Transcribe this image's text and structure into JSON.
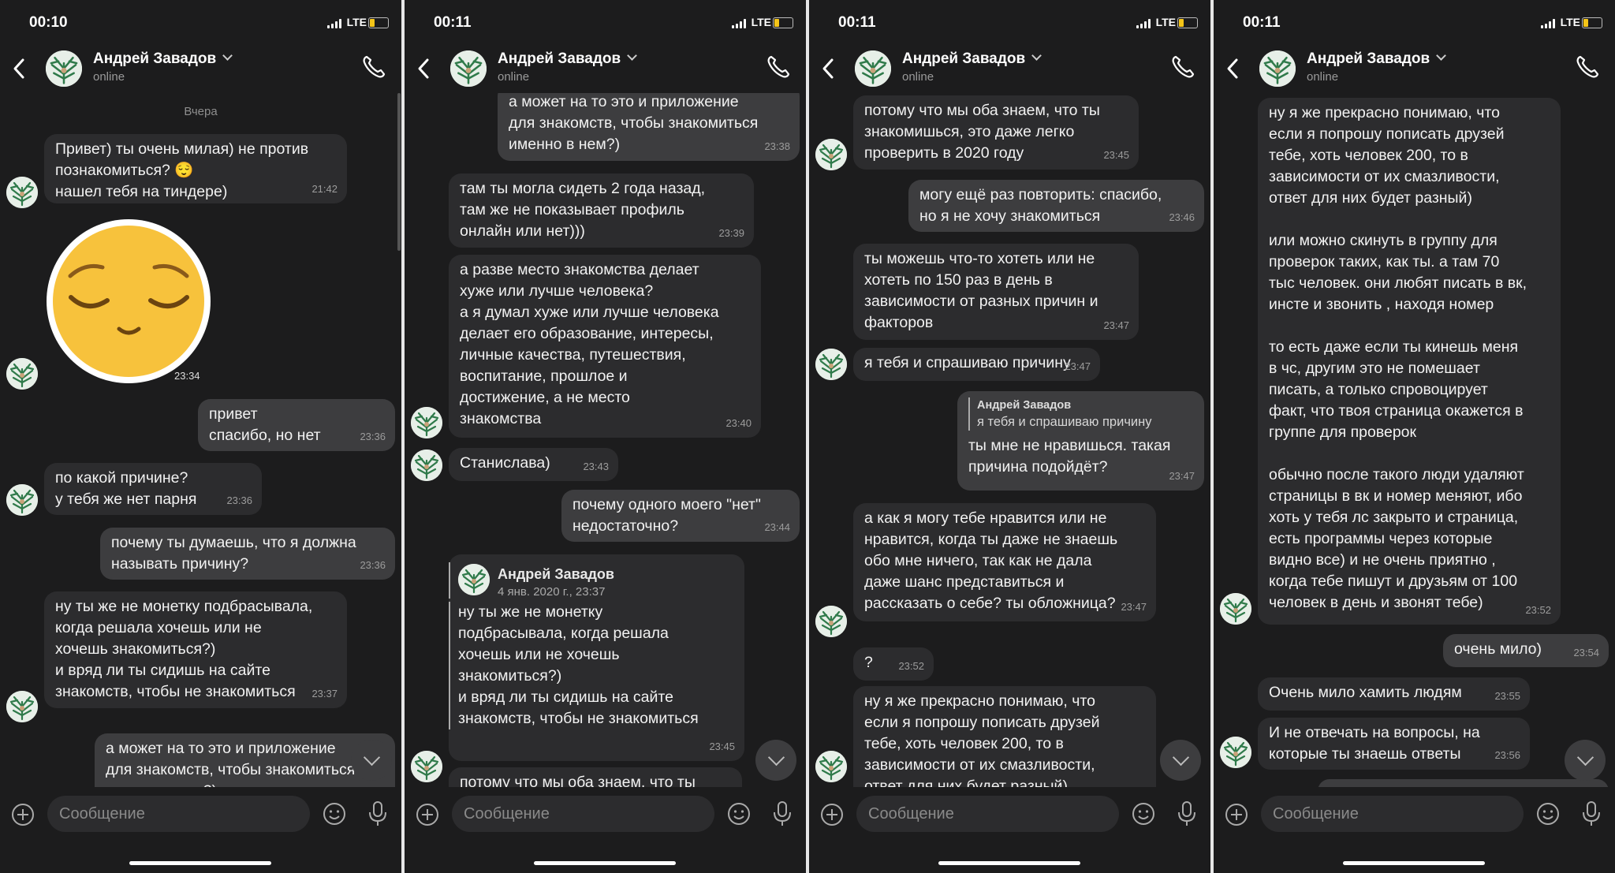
{
  "contact": {
    "name": "Андрей Завадов",
    "status": "online"
  },
  "input_placeholder": "Сообщение",
  "fwd": {
    "name": "Андрей Завадов",
    "date": "4 янв. 2020 г., 23:37"
  },
  "screens": [
    {
      "time": "00:10",
      "network": "LTE",
      "date_separator": "Вчера",
      "messages": [
        {
          "text": "Привет) ты очень милая) не против\nпознакомиться? 😌\nнашел тебя на тиндере)",
          "time": "21:42"
        },
        {
          "text": "привет\nспасибо, но нет",
          "time": "23:36"
        },
        {
          "text": "по какой причине?\nу тебя же нет парня",
          "time": "23:36"
        },
        {
          "text": "почему ты думаешь, что я должна\nназывать причину?",
          "time": "23:36"
        },
        {
          "text": "ну ты же не монетку подбрасывала,\nкогда решала хочешь или не\nхочешь знакомиться?)\nи вряд ли ты сидишь на сайте\nзнакомств, чтобы не знакомиться",
          "time": "23:37"
        },
        {
          "text": "а может на то это и приложение\nдля знакомств, чтобы знакомиться\nименно в нем?)"
        }
      ],
      "sticker_time": "23:34"
    },
    {
      "time": "00:11",
      "network": "LTE",
      "messages": [
        {
          "text": "а может на то это и приложение\nдля знакомств, чтобы знакомиться\nименно в нем?)",
          "time": "23:38"
        },
        {
          "text": "там ты могла сидеть 2 года назад,\nтам же не показывает профиль\nонлайн или нет)))",
          "time": "23:39"
        },
        {
          "text": "а разве место знакомства делает\nхуже или лучше человека?\nа я думал хуже или лучше человека\nделает его образование, интересы,\nличные качества, путешествия,\nвоспитание, прошлое и\nдостижение, а не место\nзнакомства",
          "time": "23:40"
        },
        {
          "text": "Станислава)",
          "time": "23:43"
        },
        {
          "text": "почему одного моего \"нет\"\nнедостаточно?",
          "time": "23:44"
        },
        {
          "text": "ну ты же не монетку\nподбрасывала, когда решала\nхочешь или не хочешь\nзнакомиться?)\nи вряд ли ты сидишь на сайте\nзнакомств, чтобы не знакомиться",
          "time": "23:45"
        },
        {
          "text": "потому что мы оба знаем, что ты"
        }
      ]
    },
    {
      "time": "00:11",
      "network": "LTE",
      "messages": [
        {
          "text": "потому что мы оба знаем, что ты\nзнакомишься, это даже легко\nпроверить в 2020 году",
          "time": "23:45"
        },
        {
          "text": "могу ещё раз повторить: спасибо,\nно я не хочу знакомиться",
          "time": "23:46"
        },
        {
          "text": "ты можешь что-то хотеть или не\nхотеть по 150 раз в день в\nзависимости от разных причин и\nфакторов",
          "time": "23:47"
        },
        {
          "text": "я тебя и спрашиваю причину",
          "time": "23:47"
        },
        {
          "text": "ты мне не нравишься. такая\nпричина подойдёт?",
          "time": "23:47",
          "reply_name": "Андрей Завадов",
          "reply_text": "я тебя и спрашиваю причину"
        },
        {
          "text": "а как я могу тебе нравится или не\nнравится, когда ты даже не знаешь\nобо мне ничего, так как не дала\nдаже шанс представиться и\nрассказать о себе? ты обложница?",
          "time": "23:47"
        },
        {
          "text": "?",
          "time": "23:52"
        },
        {
          "text": "ну я же прекрасно понимаю, что\nесли я попрошу пописать друзей\nтебе, хоть человек 200, то в\nзависимости от их смазливости,\nответ для них будет разный)"
        }
      ]
    },
    {
      "time": "00:11",
      "network": "LTE",
      "messages": [
        {
          "text": "ну я же прекрасно понимаю, что\nесли я попрошу пописать друзей\nтебе, хоть человек 200, то в\nзависимости от их смазливости,\nответ для них будет разный)\n\nили можно скинуть в группу для\nпроверок таких, как ты. а там 70\nтыс человек. они любят писать в вк,\nинсте и звонить , находя номер\n\nто есть даже если ты кинешь меня\nв чс, другим это не помешает\nписать, а только спровоцирует\nфакт, что твоя страница окажется в\nгруппе для проверок\n\nобычно после такого люди удаляют\nстраницы в вк и номер меняют, ибо\nхоть у тебя лс закрыто и страница,\nесть программы через которые\nвидно все) и не очень приятно ,\nкогда тебе пишут и друзьям от 100\nчеловек в день и звонят тебе)",
          "time": "23:52"
        },
        {
          "text": "очень мило)",
          "time": "23:54"
        },
        {
          "text": "Очень мило хамить людям",
          "time": "23:55"
        },
        {
          "text": "И не отвечать на вопросы, на\nкоторые ты знаешь ответы",
          "time": "23:56"
        }
      ]
    }
  ]
}
